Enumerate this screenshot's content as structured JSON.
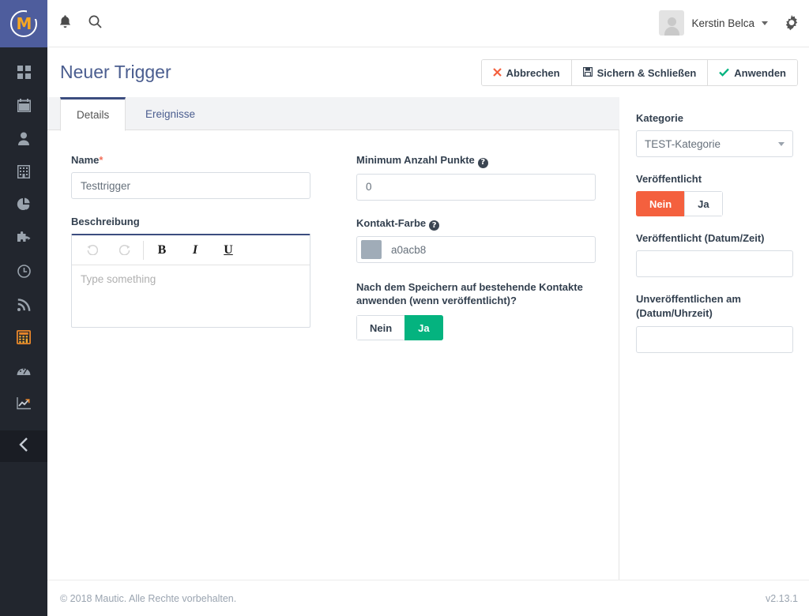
{
  "brand": {
    "logo_letter": "M",
    "logo_bg": "#4e5d9d",
    "logo_accent": "#f5a623"
  },
  "topbar": {
    "bell_icon": "bell-icon",
    "search_icon": "search-icon",
    "user_name": "Kerstin Belca",
    "settings_icon": "gear-icon"
  },
  "sidebar": {
    "items": [
      {
        "name": "dashboard",
        "icon": "grid-icon",
        "active": false
      },
      {
        "name": "calendar",
        "icon": "calendar-icon",
        "active": false
      },
      {
        "name": "contacts",
        "icon": "person-icon",
        "active": false
      },
      {
        "name": "companies",
        "icon": "building-icon",
        "active": false
      },
      {
        "name": "reports",
        "icon": "pie-chart-icon",
        "active": false
      },
      {
        "name": "plugins",
        "icon": "puzzle-icon",
        "active": false
      },
      {
        "name": "stages",
        "icon": "clock-icon",
        "active": false
      },
      {
        "name": "campaigns",
        "icon": "broadcast-icon",
        "active": false
      },
      {
        "name": "points",
        "icon": "calculator-icon",
        "active": true
      },
      {
        "name": "dynamic-content",
        "icon": "gauge-icon",
        "active": false
      },
      {
        "name": "analytics",
        "icon": "line-chart-icon",
        "active": false
      }
    ],
    "collapse_icon": "chevron-left-icon"
  },
  "header": {
    "title": "Neuer Trigger",
    "buttons": [
      {
        "key": "cancel",
        "label": "Abbrechen",
        "icon": "x-icon",
        "icon_color": "#f4603e"
      },
      {
        "key": "save_close",
        "label": "Sichern & Schließen",
        "icon": "save-icon",
        "icon_color": "#33404f"
      },
      {
        "key": "apply",
        "label": "Anwenden",
        "icon": "check-icon",
        "icon_color": "#04b37f"
      }
    ]
  },
  "tabs": [
    {
      "key": "details",
      "label": "Details",
      "active": true
    },
    {
      "key": "ereignisse",
      "label": "Ereignisse",
      "active": false
    }
  ],
  "form": {
    "name": {
      "label": "Name",
      "required_marker": "*",
      "value": "Testtrigger"
    },
    "description": {
      "label": "Beschreibung",
      "placeholder": "Type something",
      "value": "",
      "toolbar": [
        {
          "name": "undo-icon",
          "glyph": "↶"
        },
        {
          "name": "redo-icon",
          "glyph": "↷"
        },
        {
          "name": "bold-icon",
          "glyph": "B"
        },
        {
          "name": "italic-icon",
          "glyph": "I"
        },
        {
          "name": "underline-icon",
          "glyph": "U"
        }
      ]
    },
    "min_points": {
      "label": "Minimum Anzahl Punkte",
      "help_icon": "?",
      "value": "0"
    },
    "contact_color": {
      "label": "Kontakt-Farbe",
      "help_icon": "?",
      "value": "a0acb8",
      "swatch_hex": "#a0acb8"
    },
    "apply_existing": {
      "label": "Nach dem Speichern auf bestehende Kontakte anwenden (wenn veröffentlicht)?",
      "options": [
        {
          "label": "Nein",
          "selected": false
        },
        {
          "label": "Ja",
          "selected": true
        }
      ],
      "selected_color": "#04b37f"
    }
  },
  "side_panel": {
    "category": {
      "label": "Kategorie",
      "selected": "TEST-Kategorie",
      "caret_icon": "chevron-down-icon"
    },
    "published": {
      "label": "Veröffentlicht",
      "options": [
        {
          "label": "Nein",
          "selected": true
        },
        {
          "label": "Ja",
          "selected": false
        }
      ],
      "selected_color": "#f4603e"
    },
    "publish_at": {
      "label": "Veröffentlicht (Datum/Zeit)",
      "value": "",
      "placeholder": ""
    },
    "unpublish_at": {
      "label": "Unveröffentlichen am (Datum/Uhrzeit)",
      "value": "",
      "placeholder": ""
    }
  },
  "footer": {
    "copyright": "© 2018 Mautic. Alle Rechte vorbehalten.",
    "version": "v2.13.1"
  }
}
